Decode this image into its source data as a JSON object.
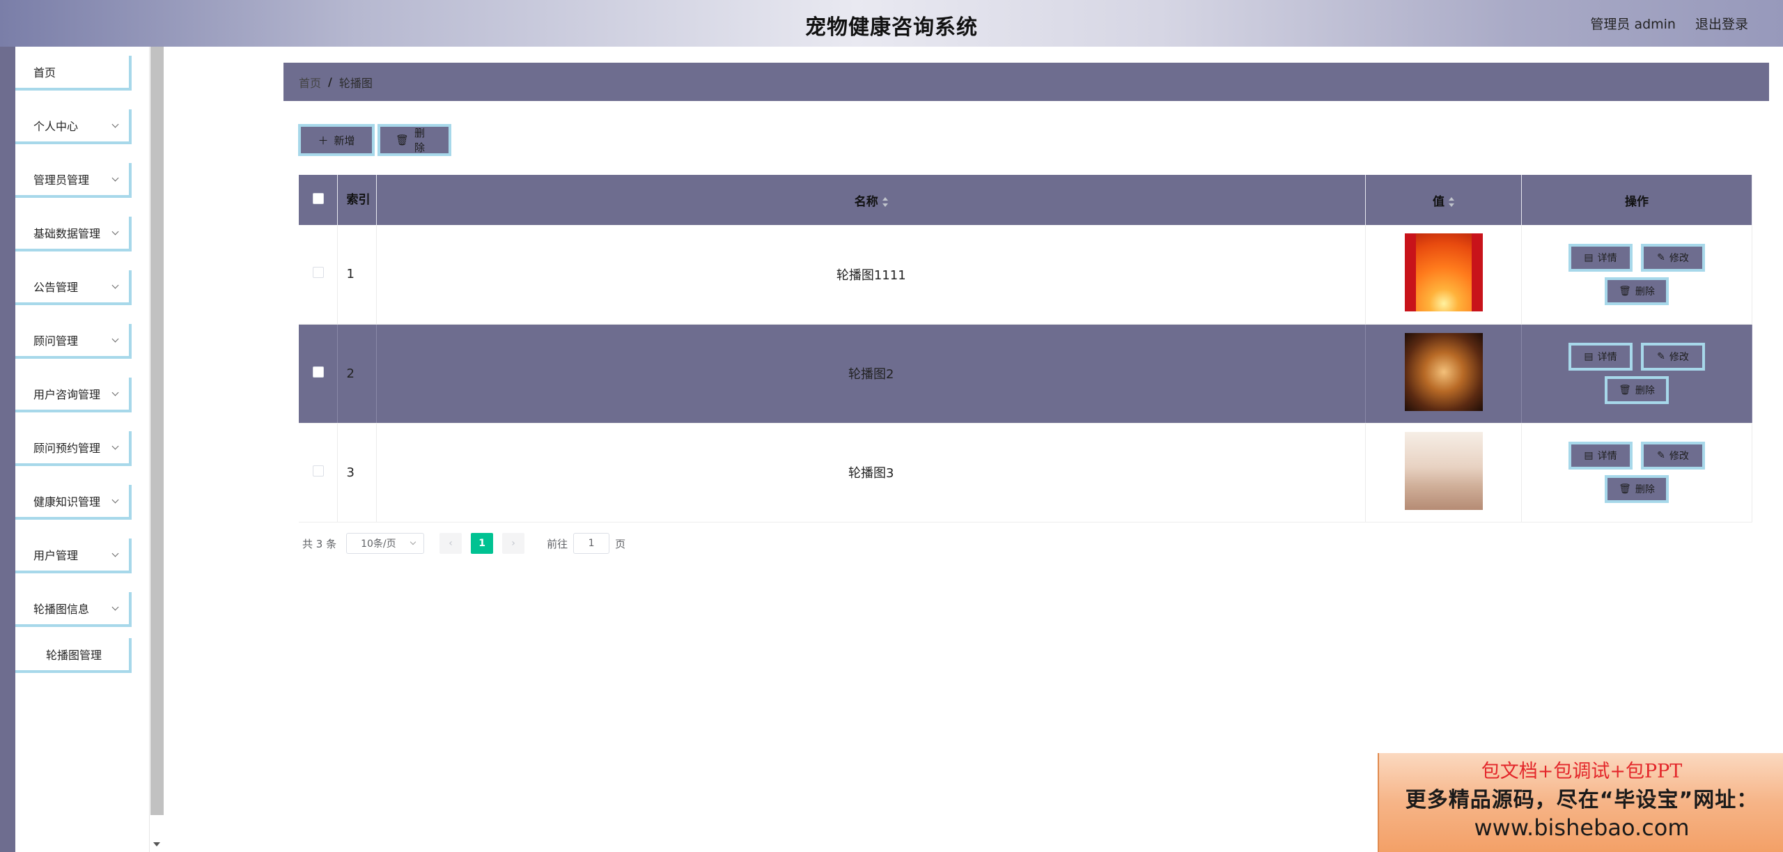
{
  "header": {
    "title": "宠物健康咨询系统",
    "user": "管理员 admin",
    "logout": "退出登录"
  },
  "sidebar": {
    "items": [
      {
        "label": "首页"
      },
      {
        "label": "个人中心"
      },
      {
        "label": "管理员管理"
      },
      {
        "label": "基础数据管理"
      },
      {
        "label": "公告管理"
      },
      {
        "label": "顾问管理"
      },
      {
        "label": "用户咨询管理"
      },
      {
        "label": "顾问预约管理"
      },
      {
        "label": "健康知识管理"
      },
      {
        "label": "用户管理"
      },
      {
        "label": "轮播图信息"
      },
      {
        "label": "轮播图管理"
      }
    ]
  },
  "breadcrumb": {
    "home": "首页",
    "sep": "/",
    "current": "轮播图"
  },
  "toolbar": {
    "add_label": "新增",
    "delete_label": "删除",
    "add_icon": "plus-icon",
    "delete_icon": "trash-icon"
  },
  "table": {
    "headers": {
      "index": "索引",
      "name": "名称",
      "value": "值",
      "ops": "操作"
    },
    "rows": [
      {
        "index": "1",
        "name": "轮播图1111",
        "image": "orange-sunburst-thumbnail"
      },
      {
        "index": "2",
        "name": "轮播图2",
        "image": "blurred-lights-thumbnail"
      },
      {
        "index": "3",
        "name": "轮播图3",
        "image": "street-scene-thumbnail"
      }
    ],
    "op_labels": {
      "detail": "详情",
      "edit": "修改",
      "delete": "删除"
    }
  },
  "pagination": {
    "total": "共 3 条",
    "page_size": "10条/页",
    "current_page": "1",
    "goto_label": "前往",
    "goto_value": "1",
    "page_suffix": "页"
  },
  "ad": {
    "line1": "包文档+包调试+包PPT",
    "line2": "更多精品源码，尽在“毕设宝”网址：",
    "line3": "www.bishebao.com"
  },
  "colors": {
    "primary": "#6e6d8f",
    "border_accent": "#a7d8ea",
    "page_active": "#00c292"
  }
}
